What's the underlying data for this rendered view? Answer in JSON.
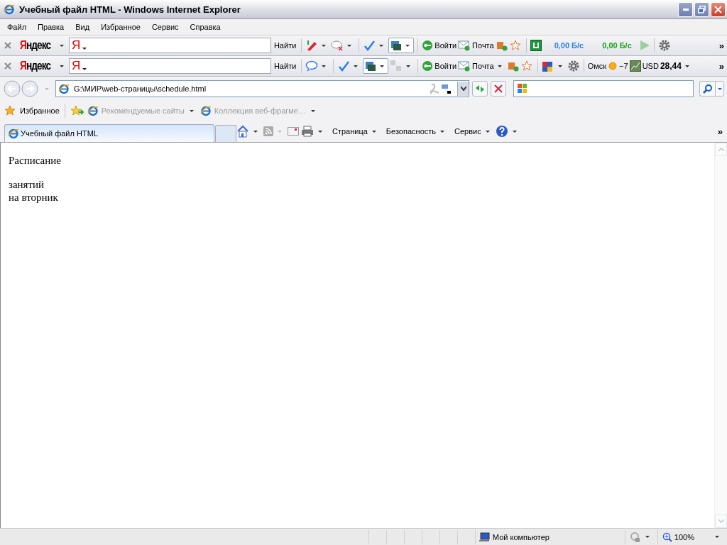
{
  "window": {
    "title": "Учебный файл HTML - Windows Internet Explorer"
  },
  "menu": [
    "Файл",
    "Правка",
    "Вид",
    "Избранное",
    "Сервис",
    "Справка"
  ],
  "yandex_toolbars": [
    {
      "logo": "Яндекс",
      "field_logo": "Я",
      "search_button": "Найти",
      "login": "Войти",
      "mail": "Почта",
      "speeds": [
        {
          "text": "0,00 Б/с",
          "color": "#2a7ee8"
        },
        {
          "text": "0,00 Б/с",
          "color": "#1aa01a"
        }
      ],
      "overflow": "»"
    },
    {
      "logo": "Яндекс",
      "field_logo": "Я",
      "search_button": "Найти",
      "login": "Войти",
      "mail": "Почта",
      "city": "Омск",
      "temperature": "−7",
      "currency": "USD",
      "rate": "28,44",
      "overflow": "»"
    }
  ],
  "address_bar": {
    "url": "G:\\МИР\\web-страницы\\schedule.html"
  },
  "favorites_bar": {
    "favorites": "Избранное",
    "links": [
      {
        "label": "Рекомендуемые сайты"
      },
      {
        "label": "Коллекция веб-фрагме…"
      }
    ]
  },
  "tabs": [
    {
      "label": "Учебный файл HTML",
      "selected": true
    }
  ],
  "command_bar": {
    "menus": [
      "Страница",
      "Безопасность",
      "Сервис"
    ],
    "overflow": "»"
  },
  "page_content": {
    "paragraphs": [
      {
        "lines": [
          "Расписание"
        ]
      },
      {
        "lines": [
          "занятий",
          "на вторник"
        ]
      }
    ]
  },
  "status_bar": {
    "zone": "Мой компьютер",
    "zoom": "100%"
  }
}
